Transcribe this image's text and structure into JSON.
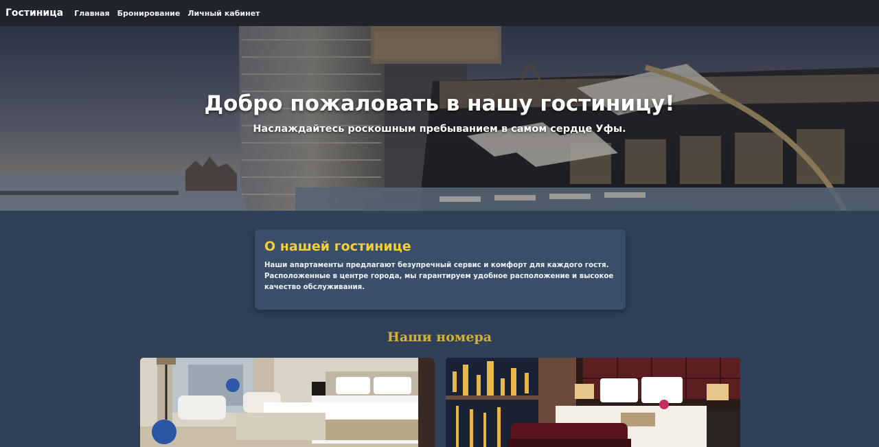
{
  "nav": {
    "brand": "Гостиница",
    "links": [
      "Главная",
      "Бронирование",
      "Личный кабинет"
    ]
  },
  "hero": {
    "title": "Добро пожаловать в нашу гостиницу!",
    "subtitle": "Наслаждайтесь роскошным пребыванием в самом сердце Уфы."
  },
  "about": {
    "title": "О нашей гостинице",
    "text": "Наши апартаменты предлагают безупречный сервис и комфорт для каждого гостя. Расположенные в центре города, мы гарантируем удобное расположение и высокое качество обслуживания."
  },
  "rooms": {
    "title": "Наши номера"
  },
  "colors": {
    "page_bg": "#2f4058",
    "navbar_bg": "#20252d",
    "card_bg": "#3a4e69",
    "accent_yellow": "#f4cf3a",
    "accent_gold": "#d3b035"
  }
}
